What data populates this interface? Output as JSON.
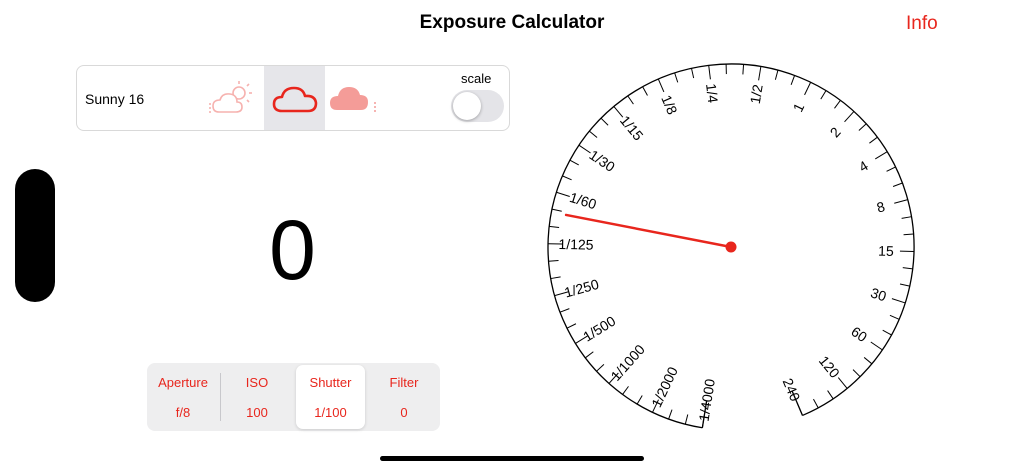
{
  "header": {
    "title": "Exposure Calculator",
    "info_label": "Info"
  },
  "weather": {
    "label": "Sunny 16",
    "scale_label": "scale",
    "scale_enabled": false,
    "options": [
      "partly-cloudy-icon",
      "cloud-icon",
      "rain-cloud-icon"
    ],
    "selected": "cloud-icon"
  },
  "main": {
    "ev_value": "0"
  },
  "segments": [
    {
      "label": "Aperture",
      "value": "f/8"
    },
    {
      "label": "ISO",
      "value": "100"
    },
    {
      "label": "Shutter",
      "value": "1/100",
      "selected": true
    },
    {
      "label": "Filter",
      "value": "0"
    }
  ],
  "dial": {
    "labels": [
      "1/4000",
      "1/2000",
      "1/1000",
      "1/500",
      "1/250",
      "1/125",
      "1/60",
      "1/30",
      "1/15",
      "1/8",
      "1/4",
      "1/2",
      "1",
      "2",
      "4",
      "8",
      "15",
      "30",
      "60",
      "120",
      "240"
    ],
    "pointer_value": "1/100"
  },
  "colors": {
    "accent": "#e8261d",
    "segment_bg": "#eeeeef"
  }
}
